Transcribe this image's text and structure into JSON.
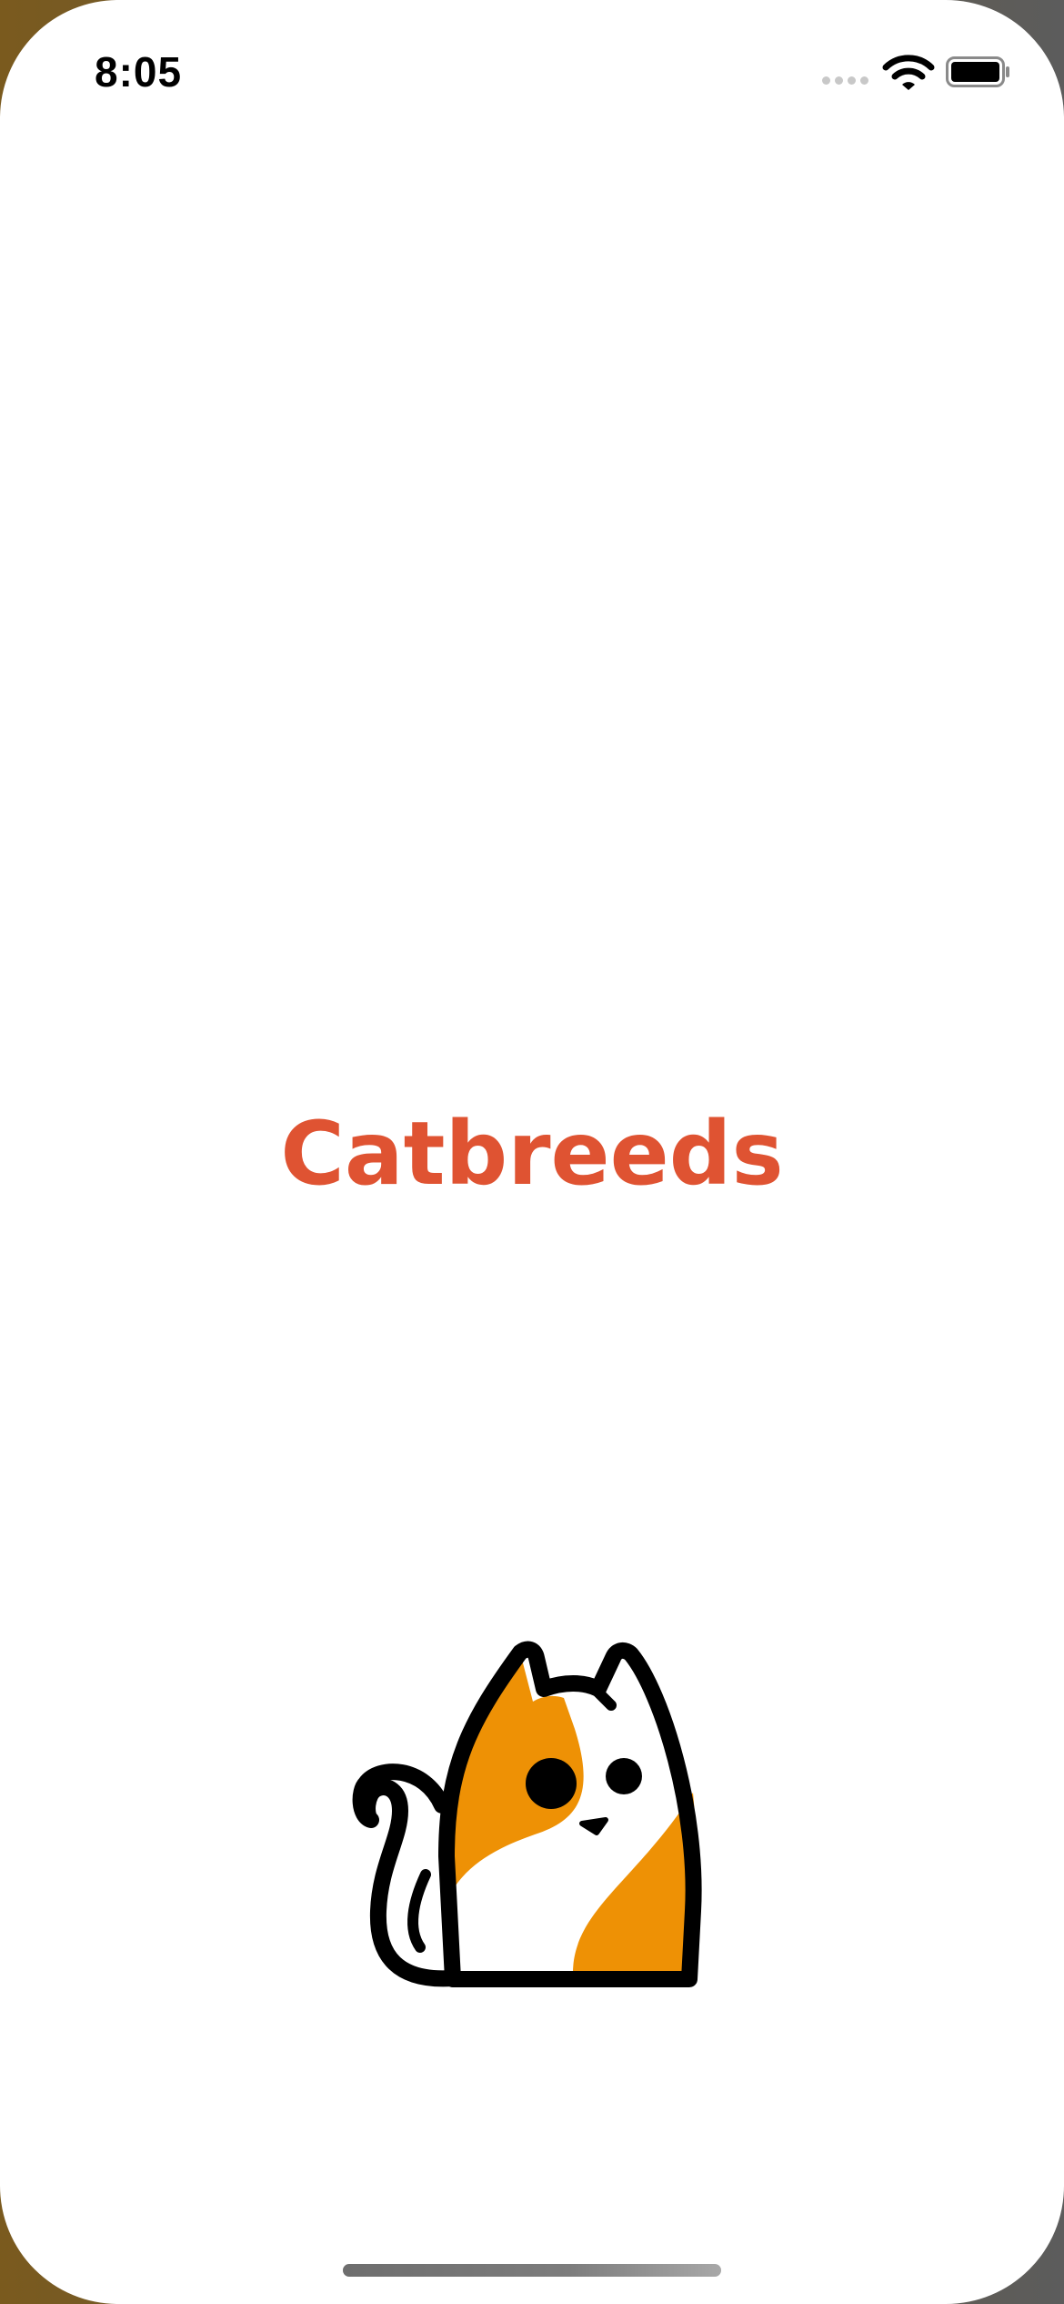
{
  "status_bar": {
    "time": "8:05",
    "signal_icon": "cellular-signal-icon",
    "wifi_icon": "wifi-icon",
    "battery_icon": "battery-icon"
  },
  "splash": {
    "title": "Catbreeds",
    "title_color": "#df5332",
    "logo_icon": "calico-cat-logo",
    "accent_color": "#ee9105"
  }
}
